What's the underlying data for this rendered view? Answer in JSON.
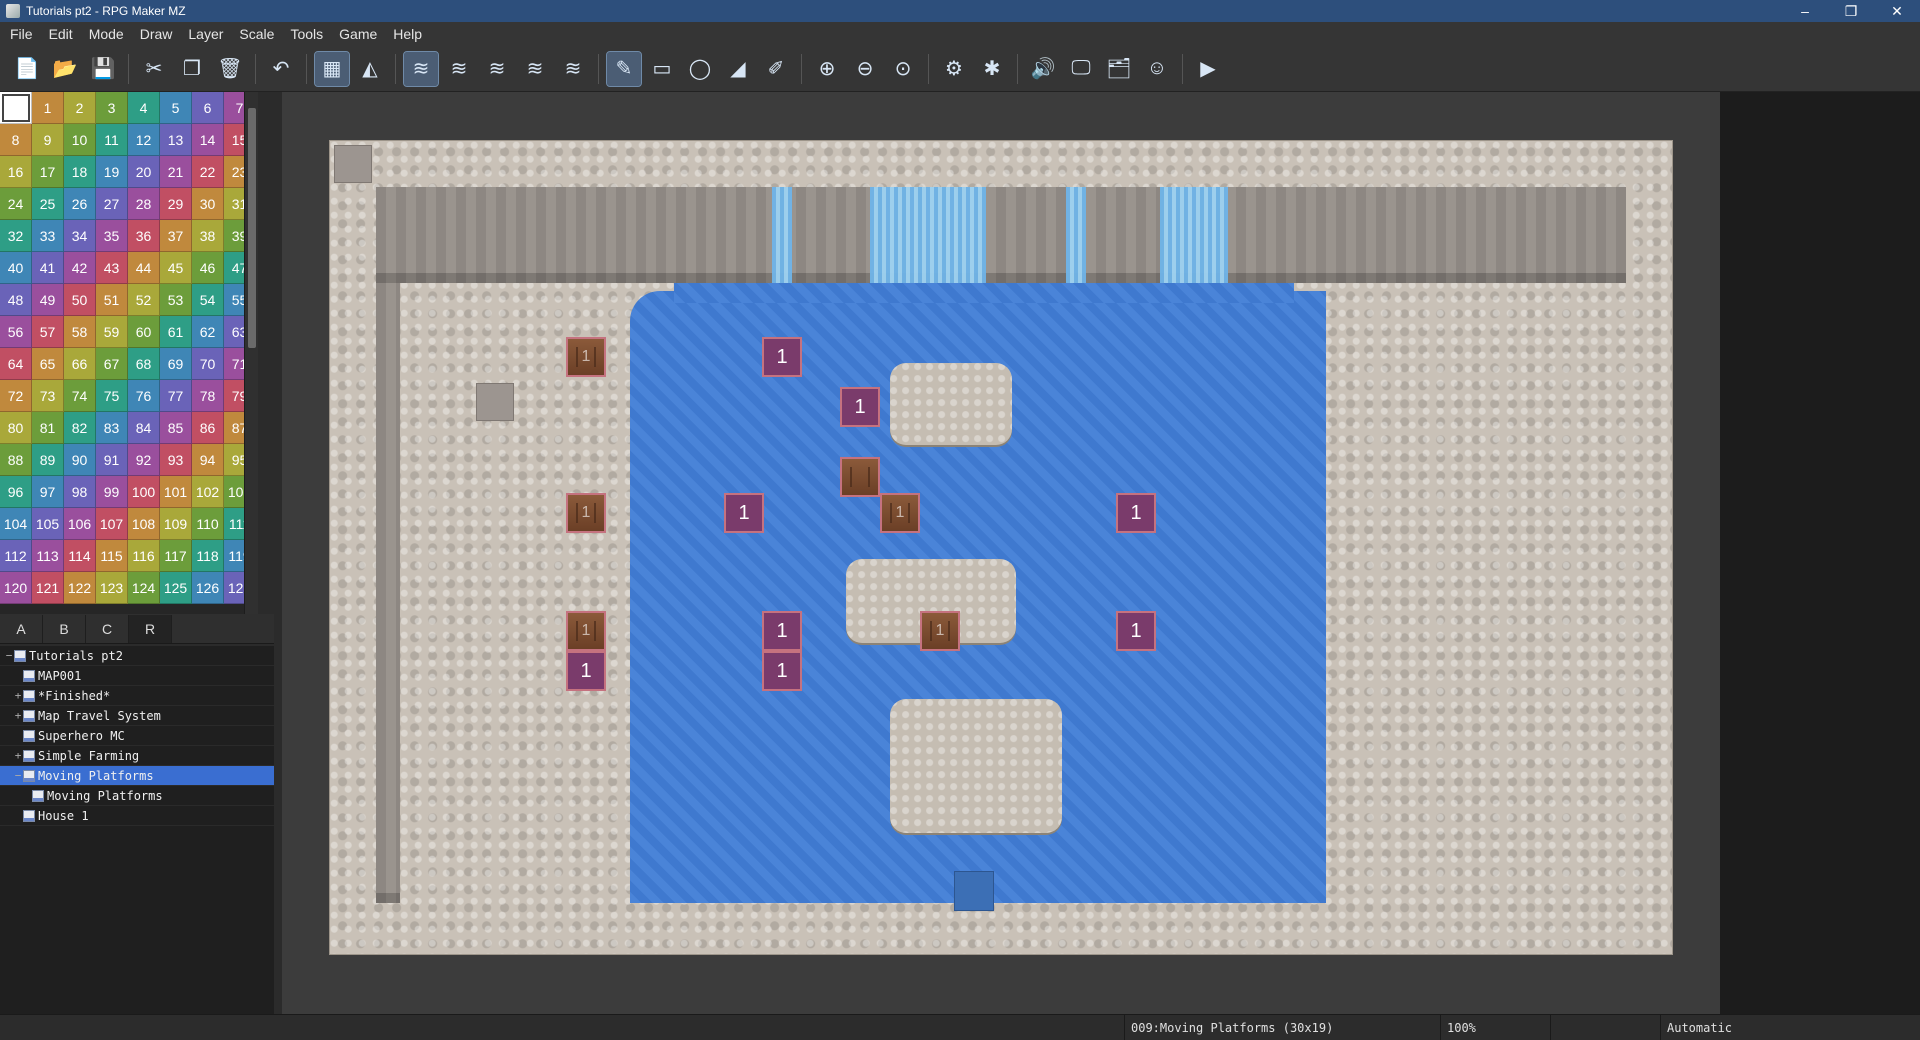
{
  "window": {
    "title": "Tutorials pt2 - RPG Maker MZ"
  },
  "menubar": [
    "File",
    "Edit",
    "Mode",
    "Draw",
    "Layer",
    "Scale",
    "Tools",
    "Game",
    "Help"
  ],
  "toolbar": [
    {
      "name": "new-project-button",
      "glyph": "📄"
    },
    {
      "name": "open-project-button",
      "glyph": "📂"
    },
    {
      "name": "save-project-button",
      "glyph": "💾"
    },
    {
      "sep": true
    },
    {
      "name": "cut-button",
      "glyph": "✂"
    },
    {
      "name": "copy-button",
      "glyph": "❐"
    },
    {
      "name": "delete-button",
      "glyph": "🗑"
    },
    {
      "sep": true
    },
    {
      "name": "undo-button",
      "glyph": "↶"
    },
    {
      "sep": true
    },
    {
      "name": "map-mode-button",
      "glyph": "▦",
      "active": true
    },
    {
      "name": "event-mode-button",
      "glyph": "◭"
    },
    {
      "sep": true
    },
    {
      "name": "layer-auto-button",
      "glyph": "≋",
      "active": true
    },
    {
      "name": "layer-1-button",
      "glyph": "≋"
    },
    {
      "name": "layer-2-button",
      "glyph": "≋"
    },
    {
      "name": "layer-3-button",
      "glyph": "≋"
    },
    {
      "name": "layer-4-button",
      "glyph": "≋"
    },
    {
      "sep": true
    },
    {
      "name": "pencil-tool-button",
      "glyph": "✎",
      "active": true
    },
    {
      "name": "rectangle-tool-button",
      "glyph": "▭"
    },
    {
      "name": "ellipse-tool-button",
      "glyph": "◯"
    },
    {
      "name": "flood-fill-button",
      "glyph": "◢"
    },
    {
      "name": "shadow-pen-button",
      "glyph": "✐"
    },
    {
      "sep": true
    },
    {
      "name": "zoom-in-button",
      "glyph": "⊕"
    },
    {
      "name": "zoom-out-button",
      "glyph": "⊖"
    },
    {
      "name": "actual-size-button",
      "glyph": "⊙"
    },
    {
      "sep": true
    },
    {
      "name": "database-button",
      "glyph": "⚙"
    },
    {
      "name": "plugin-manager-button",
      "glyph": "✱"
    },
    {
      "sep": true
    },
    {
      "name": "sound-test-button",
      "glyph": "🔊"
    },
    {
      "name": "event-searcher-button",
      "glyph": "🖵"
    },
    {
      "name": "resource-manager-button",
      "glyph": "🗂"
    },
    {
      "name": "character-generator-button",
      "glyph": "☺"
    },
    {
      "sep": true
    },
    {
      "name": "playtest-button",
      "glyph": "▶"
    }
  ],
  "palette": {
    "count": 128
  },
  "colors": [
    "#c14f63",
    "#c0893d",
    "#a9a83a",
    "#6c9d3b",
    "#2e9e86",
    "#3f86b6",
    "#6a63b8",
    "#9a4f9d"
  ],
  "tabs": [
    "A",
    "B",
    "C",
    "R"
  ],
  "tabs_active": 3,
  "maptree": [
    {
      "label": "Tutorials pt2",
      "level": 0,
      "exp": "−",
      "root": true
    },
    {
      "label": "MAP001",
      "level": 1,
      "exp": ""
    },
    {
      "label": "*Finished*",
      "level": 1,
      "exp": "+"
    },
    {
      "label": "Map Travel System",
      "level": 1,
      "exp": "+"
    },
    {
      "label": "Superhero MC",
      "level": 1,
      "exp": ""
    },
    {
      "label": "Simple Farming",
      "level": 1,
      "exp": "+"
    },
    {
      "label": "Moving Platforms",
      "level": 1,
      "exp": "−",
      "selected": true
    },
    {
      "label": "Moving Platforms",
      "level": 2,
      "exp": ""
    },
    {
      "label": "House 1",
      "level": 1,
      "exp": ""
    }
  ],
  "events": [
    {
      "kind": "crate",
      "label": "1"
    },
    {
      "kind": "plain",
      "label": "1"
    },
    {
      "kind": "plain",
      "label": "1"
    },
    {
      "kind": "crate",
      "label": ""
    },
    {
      "kind": "crate",
      "label": "1"
    },
    {
      "kind": "plain",
      "label": "1"
    },
    {
      "kind": "crate",
      "label": "1"
    },
    {
      "kind": "plain",
      "label": "1"
    },
    {
      "kind": "crate",
      "label": "1"
    },
    {
      "kind": "plain",
      "label": "1"
    },
    {
      "kind": "crate",
      "label": "1"
    },
    {
      "kind": "plain",
      "label": "1"
    },
    {
      "kind": "plain",
      "label": "1"
    },
    {
      "kind": "plain",
      "label": "1"
    }
  ],
  "status": {
    "map": "009:Moving Platforms (30x19)",
    "zoom": "100%",
    "mode": "Automatic"
  }
}
